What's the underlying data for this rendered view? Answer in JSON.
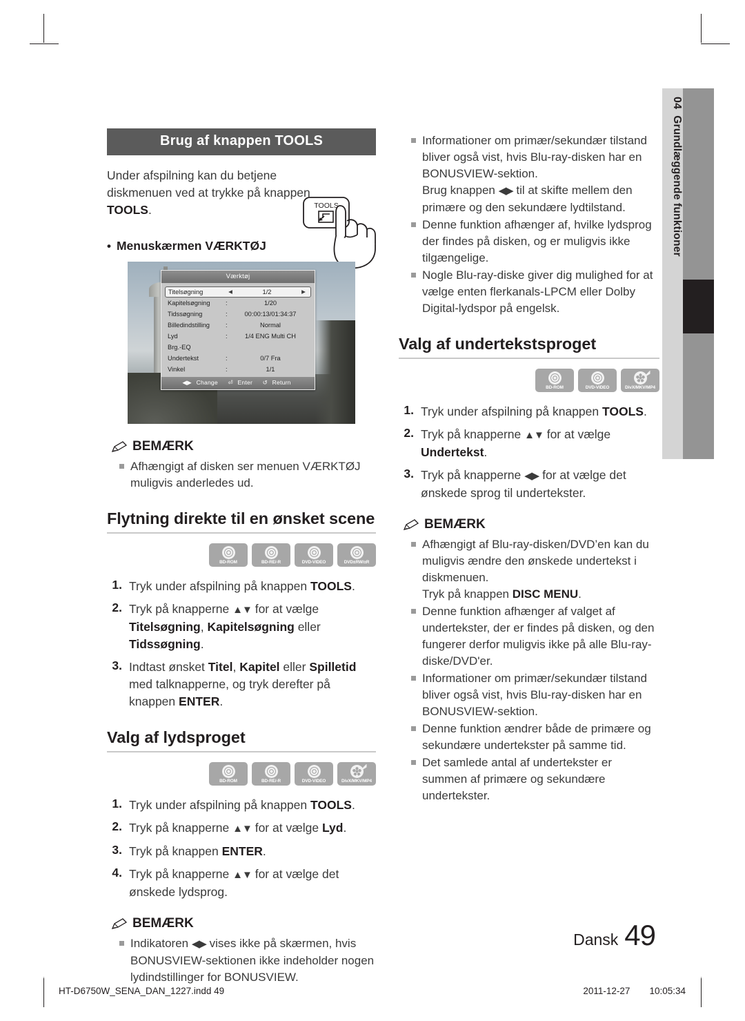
{
  "sidetab": {
    "number": "04",
    "label": "Grundlæggende funktioner"
  },
  "left": {
    "banner": "Brug af knappen TOOLS",
    "intro_a": "Under afspilning kan du betjene diskmenuen ved at trykke på knappen ",
    "intro_b": "TOOLS",
    "intro_c": ".",
    "tools_button_label": "TOOLS",
    "bullet_menu": "Menuskærmen VÆRKTØJ",
    "osd": {
      "title": "Værktøj",
      "rows": [
        {
          "label": "Titelsøgning",
          "sep": "",
          "value": "1/2",
          "selected": true
        },
        {
          "label": "Kapitelsøgning",
          "sep": ":",
          "value": "1/20",
          "selected": false
        },
        {
          "label": "Tidssøgning",
          "sep": ":",
          "value": "00:00:13/01:34:37",
          "selected": false
        },
        {
          "label": "Billedindstilling",
          "sep": ":",
          "value": "Normal",
          "selected": false
        },
        {
          "label": "Lyd",
          "sep": ":",
          "value": "1/4 ENG Multi CH",
          "selected": false
        },
        {
          "label": "Brg.-EQ",
          "sep": "",
          "value": "",
          "selected": false
        },
        {
          "label": "Undertekst",
          "sep": ":",
          "value": "0/7 Fra",
          "selected": false
        },
        {
          "label": "Vinkel",
          "sep": ":",
          "value": "1/1",
          "selected": false
        }
      ],
      "footer": {
        "change": "Change",
        "enter": "Enter",
        "return": "Return"
      }
    },
    "note1": {
      "title": "BEMÆRK",
      "items": [
        "Afhængigt af disken ser menuen VÆRKTØJ muligvis anderledes ud."
      ]
    },
    "h2_scene": "Flytning direkte til en ønsket scene",
    "discs_scene": [
      "BD-ROM",
      "BD-RE/-R",
      "DVD-VIDEO",
      "DVD±RW/±R"
    ],
    "steps_scene": [
      {
        "num": "1.",
        "html": "Tryk under afspilning på knappen <b>TOOLS</b>."
      },
      {
        "num": "2.",
        "html": "Tryk på knapperne <span class=\"arrowglyph\">▲▼</span> for at vælge <b>Titelsøgning</b>, <b>Kapitelsøgning</b> eller <b>Tidssøgning</b>."
      },
      {
        "num": "3.",
        "html": "Indtast ønsket <b>Titel</b>, <b>Kapitel</b> eller <b>Spilletid</b> med talknapperne, og tryk derefter på knappen <b>ENTER</b>."
      }
    ],
    "h2_audio": "Valg af lydsproget",
    "discs_audio": [
      "BD-ROM",
      "BD-RE/-R",
      "DVD-VIDEO",
      "DivX/MKV/MP4"
    ],
    "steps_audio": [
      {
        "num": "1.",
        "html": "Tryk under afspilning på knappen <b>TOOLS</b>."
      },
      {
        "num": "2.",
        "html": "Tryk på knapperne <span class=\"arrowglyph\">▲▼</span> for at vælge <b>Lyd</b>."
      },
      {
        "num": "3.",
        "html": "Tryk på knappen <b>ENTER</b>."
      },
      {
        "num": "4.",
        "html": "Tryk på knapperne <span class=\"arrowglyph\">▲▼</span> for at vælge det ønskede lydsprog."
      }
    ],
    "note2": {
      "title": "BEMÆRK",
      "items": [
        "Indikatoren <span class=\"arrowglyph\">◀▶</span> vises ikke på skærmen, hvis BONUSVIEW-sektionen ikke indeholder nogen lydindstillinger for BONUSVIEW."
      ]
    }
  },
  "right": {
    "top_notes": [
      "Informationer om primær/sekundær tilstand bliver også vist, hvis Blu-ray-disken har en BONUSVIEW-sektion.<br>Brug knappen <span class=\"arrowglyph\">◀▶</span> til at skifte mellem den primære og den sekundære lydtilstand.",
      "Denne funktion afhænger af, hvilke lydsprog der findes på disken, og er muligvis ikke tilgængelige.",
      "Nogle Blu-ray-diske giver dig mulighed for at vælge enten flerkanals-LPCM eller Dolby Digital-lydspor på engelsk."
    ],
    "h2_subtitle": "Valg af undertekstsproget",
    "discs_subtitle": [
      "BD-ROM",
      "DVD-VIDEO",
      "DivX/MKV/MP4"
    ],
    "steps_subtitle": [
      {
        "num": "1.",
        "html": "Tryk under afspilning på knappen <b>TOOLS</b>."
      },
      {
        "num": "2.",
        "html": "Tryk på knapperne <span class=\"arrowglyph\">▲▼</span> for at vælge <b>Undertekst</b>."
      },
      {
        "num": "3.",
        "html": "Tryk på knapperne <span class=\"arrowglyph\">◀▶</span> for at vælge det ønskede sprog til undertekster."
      }
    ],
    "note": {
      "title": "BEMÆRK",
      "items": [
        "Afhængigt af Blu-ray-disken/DVD’en kan du muligvis ændre den ønskede undertekst i diskmenuen.<br>Tryk på knappen <b>DISC MENU</b>.",
        "Denne funktion afhænger af valget af undertekster, der er findes på disken, og den fungerer derfor muligvis ikke på alle Blu-ray-diske/DVD'er.",
        "Informationer om primær/sekundær tilstand bliver også vist, hvis Blu-ray-disken har en BONUSVIEW-sektion.",
        "Denne funktion ændrer både de primære og sekundære undertekster på samme tid.",
        "Det samlede antal af undertekster er summen af primære og sekundære undertekster."
      ]
    }
  },
  "page": {
    "language": "Dansk",
    "number": "49"
  },
  "footer": {
    "file": "HT-D6750W_SENA_DAN_1227.indd   49",
    "date": "2011-12-27",
    "time": "10:05:34"
  }
}
